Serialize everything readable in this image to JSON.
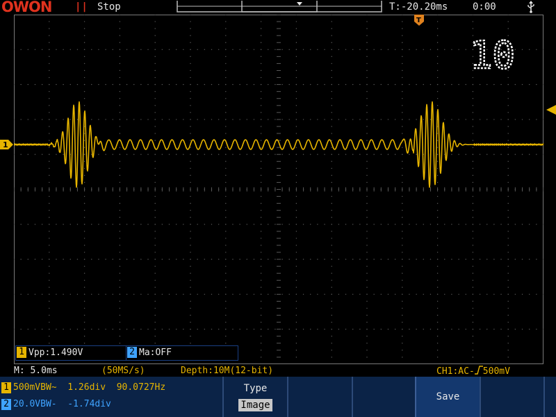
{
  "topbar": {
    "brand": "OWON",
    "run_icon": "||",
    "run_status": "Stop",
    "timebase_position": "T:-20.20ms",
    "clock": "0:00",
    "usb_icon": "usb-icon"
  },
  "display": {
    "avg_count": "10",
    "ch1_marker_label": "1",
    "trace_color": "#e7b500",
    "grid_color": "#5a5a5a",
    "trigger_color": "#e7b500"
  },
  "measurements": [
    {
      "channel": "1",
      "text": "Vpp:1.490V",
      "color": "#e7b500"
    },
    {
      "channel": "2",
      "text": "Ma:OFF",
      "color": "#3fa3ff"
    }
  ],
  "status": {
    "timebase": "M: 5.0ms",
    "sample_rate": "(50MS/s)",
    "depth": "Depth:10M(12-bit)",
    "trigger_prefix": "CH1:AC-",
    "trigger_level": "500mV"
  },
  "channels": [
    {
      "number": "1",
      "info": "500mVBW~  1.26div  90.0727Hz",
      "color": "#e7b500"
    },
    {
      "number": "2",
      "info": "20.0VBW-  -1.74div",
      "color": "#3fa3ff"
    }
  ],
  "softkeys": {
    "type_label": "Type",
    "type_value": "Image",
    "save_label": "Save"
  }
}
